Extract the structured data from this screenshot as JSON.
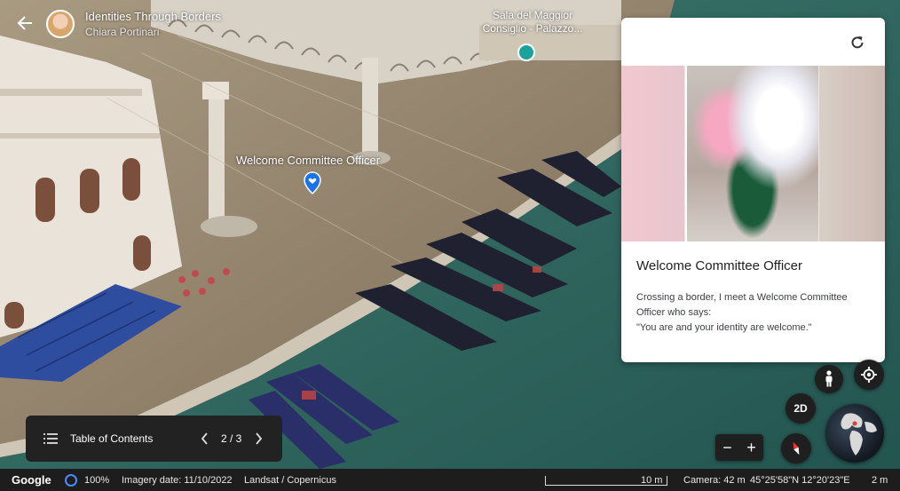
{
  "header": {
    "back_icon": "arrow-left-icon",
    "title": "Identities Through Borders",
    "author": "Chiara Portinari"
  },
  "map_labels": {
    "poi_name_line1": "Sala del Maggior",
    "poi_name_line2": "Consiglio - Palazzo...",
    "placemark_label": "Welcome Committee Officer"
  },
  "panel": {
    "title": "Welcome Committee Officer",
    "body_line1": "Crossing a border, I meet a Welcome Committee",
    "body_line2": "Officer who says:",
    "body_line3": "\"You are and your identity are welcome.\"",
    "refresh_icon": "refresh-icon"
  },
  "toc": {
    "icon": "list-icon",
    "label": "Table of Contents",
    "page": "2 / 3"
  },
  "controls": {
    "mode_2d": "2D",
    "zoom_out": "−",
    "zoom_in": "+"
  },
  "status_bar": {
    "logo": "Google",
    "loading": "100%",
    "imagery_date": "Imagery date: 11/10/2022",
    "source": "Landsat / Copernicus",
    "scale": "10 m",
    "camera": "Camera: 42 m",
    "coords": "45°25'58\"N 12°20'23\"E",
    "elevation": "2 m"
  },
  "colors": {
    "panel_bg": "#ffffff",
    "bar_bg": "#1d1d1d",
    "water": "#2f6a63",
    "marker": "#1a73e8"
  }
}
